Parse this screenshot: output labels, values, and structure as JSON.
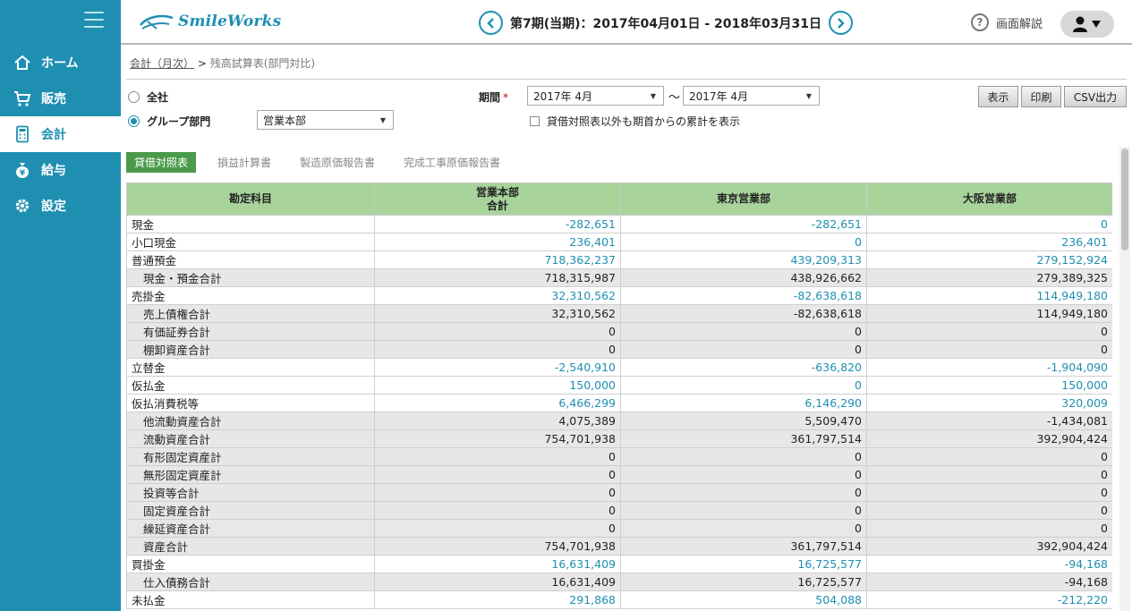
{
  "brand": {
    "name": "SmileWorks"
  },
  "header": {
    "period": "第7期(当期)：2017年04月01日 - 2018年03月31日",
    "help_label": "画面解説"
  },
  "sidebar": {
    "items": [
      {
        "label": "ホーム",
        "icon": "home-icon"
      },
      {
        "label": "販売",
        "icon": "cart-icon"
      },
      {
        "label": "会計",
        "icon": "calculator-icon",
        "active": true
      },
      {
        "label": "給与",
        "icon": "money-bag-icon"
      },
      {
        "label": "設定",
        "icon": "gear-icon"
      }
    ]
  },
  "breadcrumb": {
    "parent": "会計（月次）",
    "separator": ">",
    "current": "残高試算表(部門対比)"
  },
  "filters": {
    "scope_all": "全社",
    "scope_group": "グループ部門",
    "group_value": "営業本部",
    "period_label": "期間",
    "period_from": "2017年 4月",
    "period_tilde": "〜",
    "period_to": "2017年 4月",
    "cumulative_label": "貸借対照表以外も期首からの累計を表示"
  },
  "actions": {
    "show": "表示",
    "print": "印刷",
    "csv": "CSV出力"
  },
  "tabs": [
    "貸借対照表",
    "損益計算書",
    "製造原価報告書",
    "完成工事原価報告書"
  ],
  "table": {
    "headers": {
      "account": "勘定科目",
      "col1_line1": "営業本部",
      "col1_line2": "合計",
      "col2": "東京営業部",
      "col3": "大阪営業部"
    },
    "rows": [
      {
        "name": "現金",
        "v1": "-282,651",
        "v2": "-282,651",
        "v3": "0",
        "sub": false
      },
      {
        "name": "小口現金",
        "v1": "236,401",
        "v2": "0",
        "v3": "236,401",
        "sub": false
      },
      {
        "name": "普通預金",
        "v1": "718,362,237",
        "v2": "439,209,313",
        "v3": "279,152,924",
        "sub": false
      },
      {
        "name": "現金・預金合計",
        "v1": "718,315,987",
        "v2": "438,926,662",
        "v3": "279,389,325",
        "sub": true
      },
      {
        "name": "売掛金",
        "v1": "32,310,562",
        "v2": "-82,638,618",
        "v3": "114,949,180",
        "sub": false
      },
      {
        "name": "売上債権合計",
        "v1": "32,310,562",
        "v2": "-82,638,618",
        "v3": "114,949,180",
        "sub": true
      },
      {
        "name": "有価証券合計",
        "v1": "0",
        "v2": "0",
        "v3": "0",
        "sub": true
      },
      {
        "name": "棚卸資産合計",
        "v1": "0",
        "v2": "0",
        "v3": "0",
        "sub": true
      },
      {
        "name": "立替金",
        "v1": "-2,540,910",
        "v2": "-636,820",
        "v3": "-1,904,090",
        "sub": false
      },
      {
        "name": "仮払金",
        "v1": "150,000",
        "v2": "0",
        "v3": "150,000",
        "sub": false
      },
      {
        "name": "仮払消費税等",
        "v1": "6,466,299",
        "v2": "6,146,290",
        "v3": "320,009",
        "sub": false
      },
      {
        "name": "他流動資産合計",
        "v1": "4,075,389",
        "v2": "5,509,470",
        "v3": "-1,434,081",
        "sub": true
      },
      {
        "name": "流動資産合計",
        "v1": "754,701,938",
        "v2": "361,797,514",
        "v3": "392,904,424",
        "sub": true
      },
      {
        "name": "有形固定資産計",
        "v1": "0",
        "v2": "0",
        "v3": "0",
        "sub": true
      },
      {
        "name": "無形固定資産計",
        "v1": "0",
        "v2": "0",
        "v3": "0",
        "sub": true
      },
      {
        "name": "投資等合計",
        "v1": "0",
        "v2": "0",
        "v3": "0",
        "sub": true
      },
      {
        "name": "固定資産合計",
        "v1": "0",
        "v2": "0",
        "v3": "0",
        "sub": true
      },
      {
        "name": "繰延資産合計",
        "v1": "0",
        "v2": "0",
        "v3": "0",
        "sub": true
      },
      {
        "name": "資産合計",
        "v1": "754,701,938",
        "v2": "361,797,514",
        "v3": "392,904,424",
        "sub": true
      },
      {
        "name": "買掛金",
        "v1": "16,631,409",
        "v2": "16,725,577",
        "v3": "-94,168",
        "sub": false
      },
      {
        "name": "仕入債務合計",
        "v1": "16,631,409",
        "v2": "16,725,577",
        "v3": "-94,168",
        "sub": true
      },
      {
        "name": "未払金",
        "v1": "291,868",
        "v2": "504,088",
        "v3": "-212,220",
        "sub": false
      }
    ]
  },
  "colors": {
    "brand": "#1f8fb1",
    "header_green": "#a8d49c",
    "tab_green": "#4b9a4b"
  }
}
